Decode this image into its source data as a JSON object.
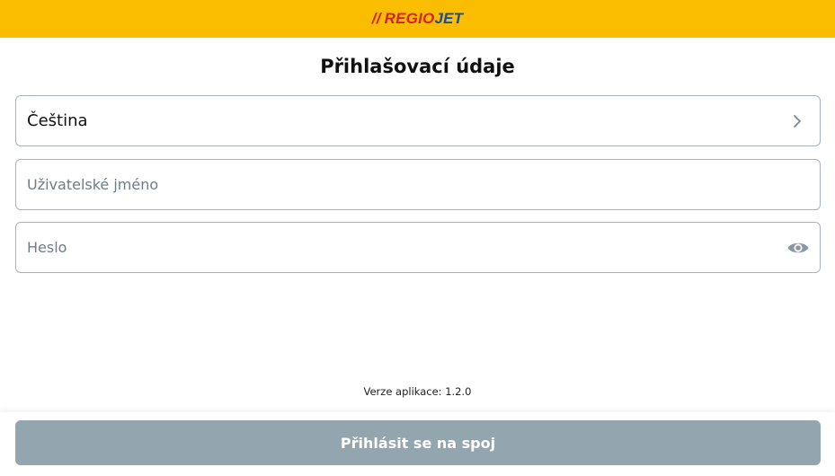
{
  "header": {
    "logo": {
      "slashes": "//",
      "regio": "REGIO",
      "jet": "JET"
    },
    "background_color": "#fbbd00"
  },
  "title": "Přihlašovací údaje",
  "language_field": {
    "value": "Čeština",
    "icon": "chevron-right-icon"
  },
  "username_field": {
    "placeholder": "Uživatelské jméno",
    "value": ""
  },
  "password_field": {
    "placeholder": "Heslo",
    "value": "",
    "icon": "eye-icon"
  },
  "version_text": "Verze aplikace: 1.2.0",
  "login_button": {
    "label": "Přihlásit se na spoj",
    "color": "#93a5ae"
  }
}
